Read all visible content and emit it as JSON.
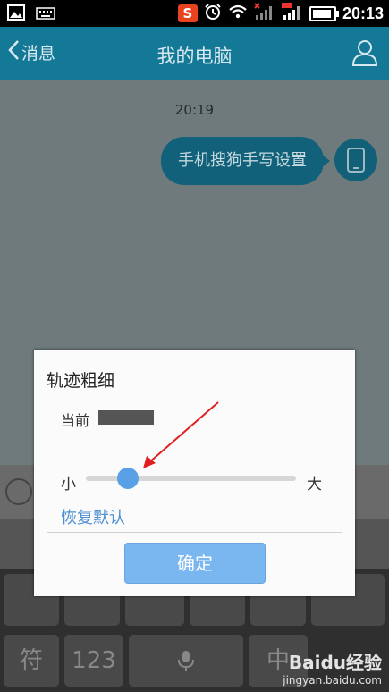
{
  "status_bar": {
    "sogou_badge": "S",
    "time": "20:13"
  },
  "app_bar": {
    "back_label": "消息",
    "title": "我的电脑"
  },
  "chat": {
    "timestamp": "20:19",
    "message": "手机搜狗手写设置"
  },
  "dialog": {
    "title": "轨迹粗细",
    "current_label": "当前",
    "small_label": "小",
    "large_label": "大",
    "slider_value_fraction": 0.2,
    "reset_label": "恢复默认",
    "confirm_label": "确定"
  },
  "keyboard": {
    "keys": [
      "符",
      "123",
      "中"
    ]
  },
  "watermark": {
    "main": "Baidu经验",
    "sub": "jingyan.baidu.com"
  },
  "colors": {
    "app_bar": "#147897",
    "slider_thumb": "#5aa0e6",
    "confirm_button": "#7ab6ef",
    "reset_link": "#4c8fd3",
    "annotation_arrow": "#e02020"
  }
}
